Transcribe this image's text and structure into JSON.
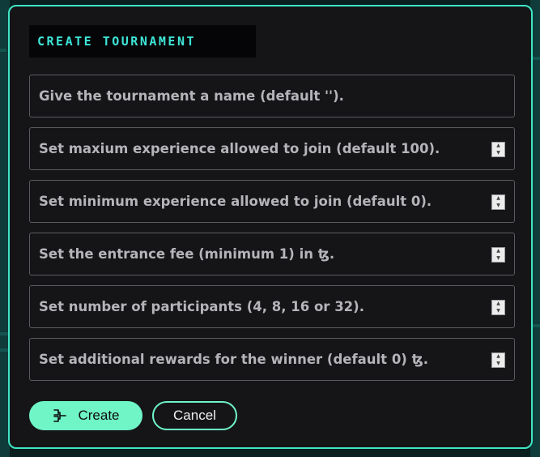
{
  "modal": {
    "title": "Create Tournament"
  },
  "fields": [
    {
      "placeholder": "Give the tournament a name (default '').",
      "type": "text"
    },
    {
      "placeholder": "Set maxium experience allowed to join (default 100).",
      "type": "number"
    },
    {
      "placeholder": "Set minimum experience allowed to join (default 0).",
      "type": "number"
    },
    {
      "placeholder": "Set the entrance fee (minimum 1) in ꜩ.",
      "type": "number"
    },
    {
      "placeholder": "Set number of participants (4, 8, 16 or 32).",
      "type": "number"
    },
    {
      "placeholder": "Set additional rewards for the winner (default 0) ꜩ.",
      "type": "number"
    }
  ],
  "buttons": {
    "create_label": "Create",
    "create_icon": "tournament-bracket-icon",
    "cancel_label": "Cancel"
  },
  "colors": {
    "accent": "#3ee6c4",
    "button": "#6ff5c6",
    "background": "#151518"
  }
}
